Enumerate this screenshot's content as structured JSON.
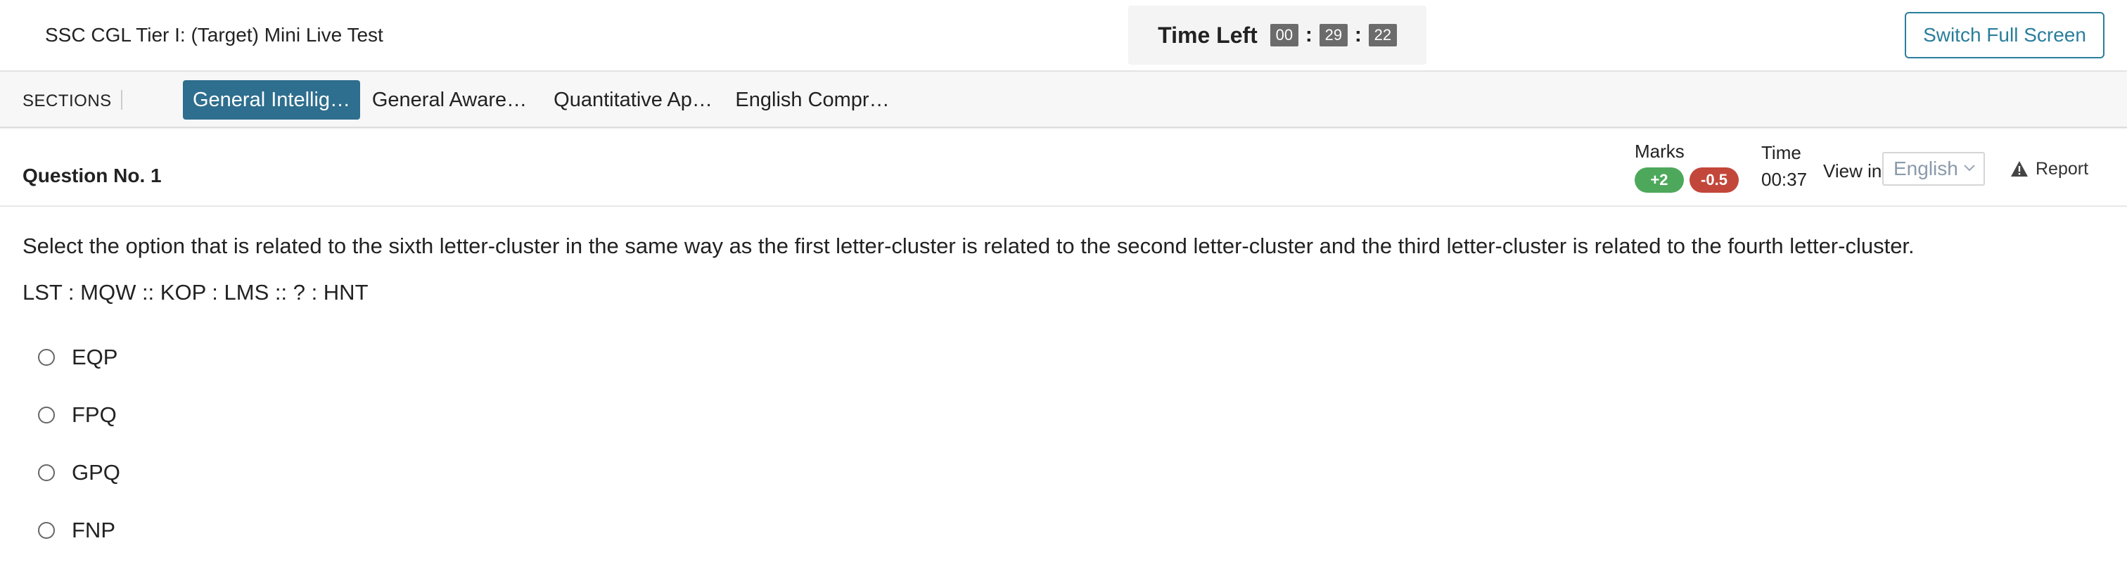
{
  "header": {
    "title": "SSC CGL Tier I: (Target) Mini Live Test",
    "timer": {
      "label": "Time Left",
      "hours": "00",
      "minutes": "29",
      "seconds": "22"
    },
    "fullscreen_label": "Switch Full Screen"
  },
  "sections": {
    "label": "SECTIONS",
    "tabs": [
      {
        "label": "General Intellig…",
        "active": true
      },
      {
        "label": "General Aware…",
        "active": false
      },
      {
        "label": "Quantitative Ap…",
        "active": false
      },
      {
        "label": "English Compr…",
        "active": false
      }
    ]
  },
  "question": {
    "number_label": "Question No. 1",
    "marks_label": "Marks",
    "positive_marks": "+2",
    "negative_marks": "-0.5",
    "time_label": "Time",
    "time_value": "00:37",
    "view_in_label": "View in",
    "language": "English",
    "report_label": "Report",
    "text": "Select the option that is related to the sixth letter-cluster in the same way as the first letter-cluster is related to the second letter-cluster and the third letter-cluster is related to the fourth letter-cluster.",
    "clusters": "LST : MQW :: KOP : LMS :: ? : HNT",
    "options": [
      "EQP",
      "FPQ",
      "GPQ",
      "FNP"
    ]
  },
  "colors": {
    "accent": "#2e6e8e",
    "button_border": "#2a7e9b",
    "positive": "#4ea85c",
    "negative": "#c2473a"
  }
}
